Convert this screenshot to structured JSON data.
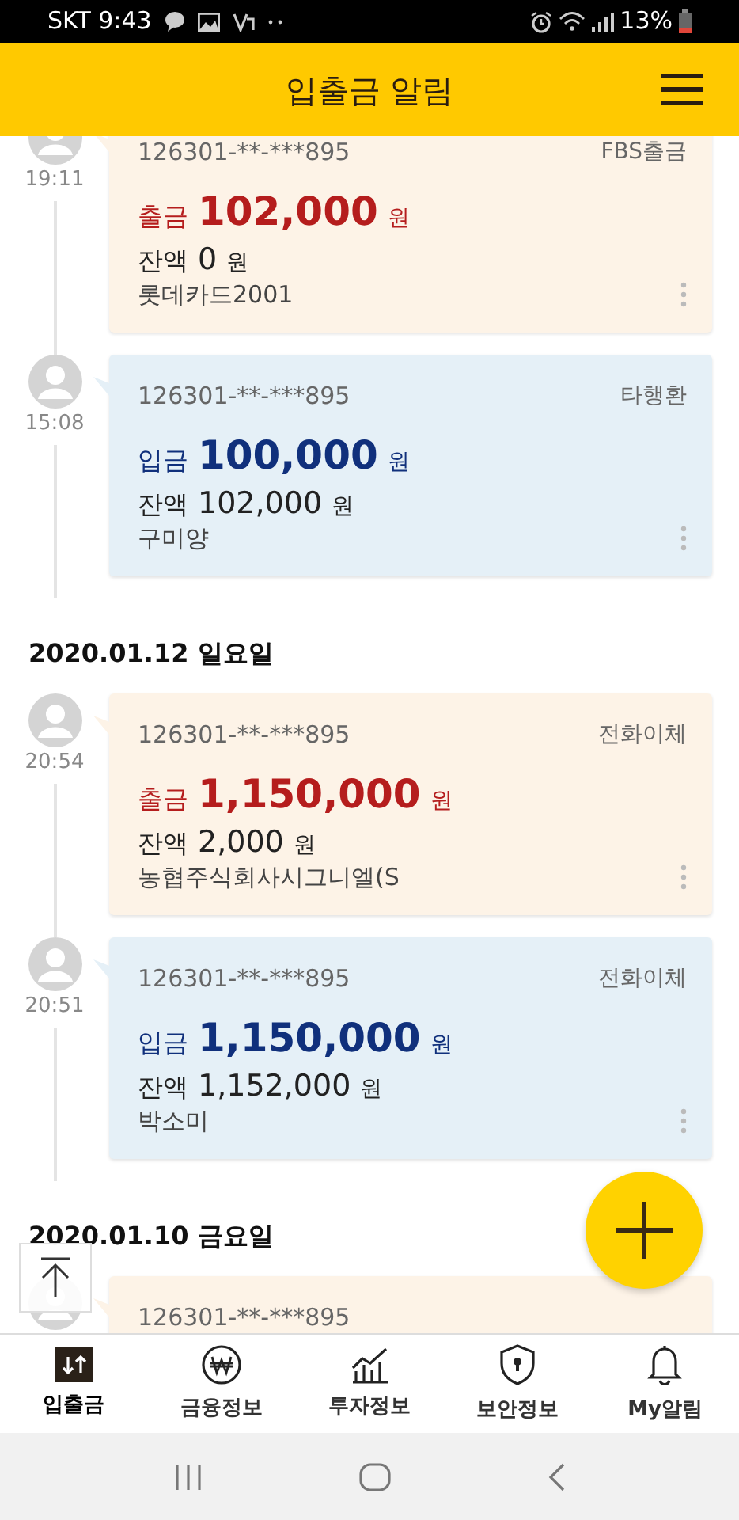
{
  "status_bar": {
    "carrier_time": "SKT 9:43",
    "battery": "13%"
  },
  "header": {
    "title": "입출금 알림"
  },
  "feed": [
    {
      "kind": "withdrawal",
      "time": "19:11",
      "account": "126301-**-***895",
      "type": "FBS출금",
      "amount_label": "출금",
      "amount": "102,000",
      "unit": "원",
      "balance_label": "잔액",
      "balance": "0",
      "balance_unit": "원",
      "memo": "롯데카드2001"
    },
    {
      "kind": "deposit",
      "time": "15:08",
      "account": "126301-**-***895",
      "type": "타행환",
      "amount_label": "입금",
      "amount": "100,000",
      "unit": "원",
      "balance_label": "잔액",
      "balance": "102,000",
      "balance_unit": "원",
      "memo": "구미양"
    },
    {
      "kind": "date",
      "label": "2020.01.12 일요일"
    },
    {
      "kind": "withdrawal",
      "time": "20:54",
      "account": "126301-**-***895",
      "type": "전화이체",
      "amount_label": "출금",
      "amount": "1,150,000",
      "unit": "원",
      "balance_label": "잔액",
      "balance": "2,000",
      "balance_unit": "원",
      "memo": "농협주식회사시그니엘(S"
    },
    {
      "kind": "deposit",
      "time": "20:51",
      "account": "126301-**-***895",
      "type": "전화이체",
      "amount_label": "입금",
      "amount": "1,150,000",
      "unit": "원",
      "balance_label": "잔액",
      "balance": "1,152,000",
      "balance_unit": "원",
      "memo": "박소미"
    },
    {
      "kind": "date",
      "label": "2020.01.10 금요일"
    },
    {
      "kind": "withdrawal",
      "account": "126301-**-***895"
    }
  ],
  "bottom_nav": [
    {
      "label": "입출금",
      "selected": true
    },
    {
      "label": "금융정보",
      "selected": false
    },
    {
      "label": "투자정보",
      "selected": false
    },
    {
      "label": "보안정보",
      "selected": false
    },
    {
      "label": "My알림",
      "selected": false
    }
  ]
}
